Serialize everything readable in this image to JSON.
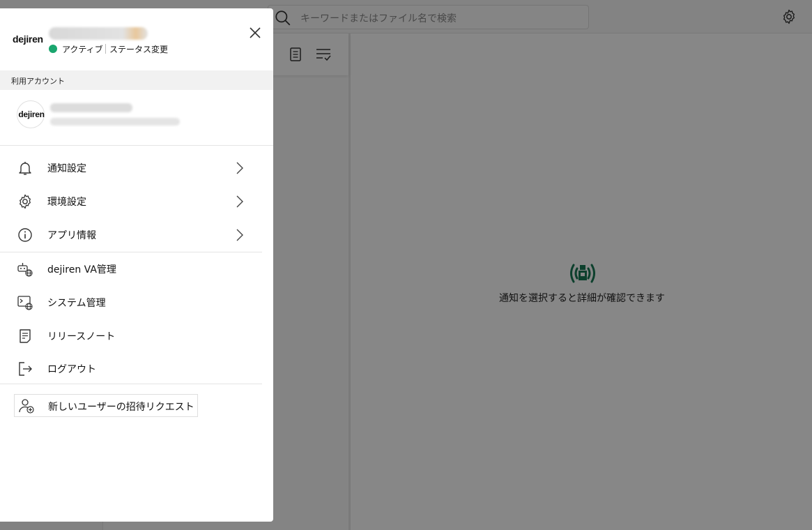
{
  "search": {
    "placeholder": "キーワードまたはファイル名で検索"
  },
  "detail": {
    "empty_message": "通知を選択すると詳細が確認できます"
  },
  "panel": {
    "brand": "dejiren",
    "status": {
      "label": "アクティブ",
      "change_label": "ステータス変更"
    },
    "accounts_section_title": "利用アカウント",
    "account_avatar_text": "dejiren",
    "menu_settings": [
      {
        "label": "通知設定",
        "icon": "bell-icon"
      },
      {
        "label": "環境設定",
        "icon": "gear-icon"
      },
      {
        "label": "アプリ情報",
        "icon": "info-icon"
      }
    ],
    "menu_admin": [
      {
        "label": "dejiren VA管理",
        "icon": "robot-globe-icon"
      },
      {
        "label": "システム管理",
        "icon": "terminal-globe-icon"
      },
      {
        "label": "リリースノート",
        "icon": "document-icon"
      },
      {
        "label": "ログアウト",
        "icon": "logout-icon"
      }
    ],
    "invite_label": "新しいユーザーの招待リクエスト"
  },
  "colors": {
    "status_active": "#1aa66e",
    "brand_green": "#1a7a55",
    "overlay": "rgba(0,0,0,0.47)"
  }
}
